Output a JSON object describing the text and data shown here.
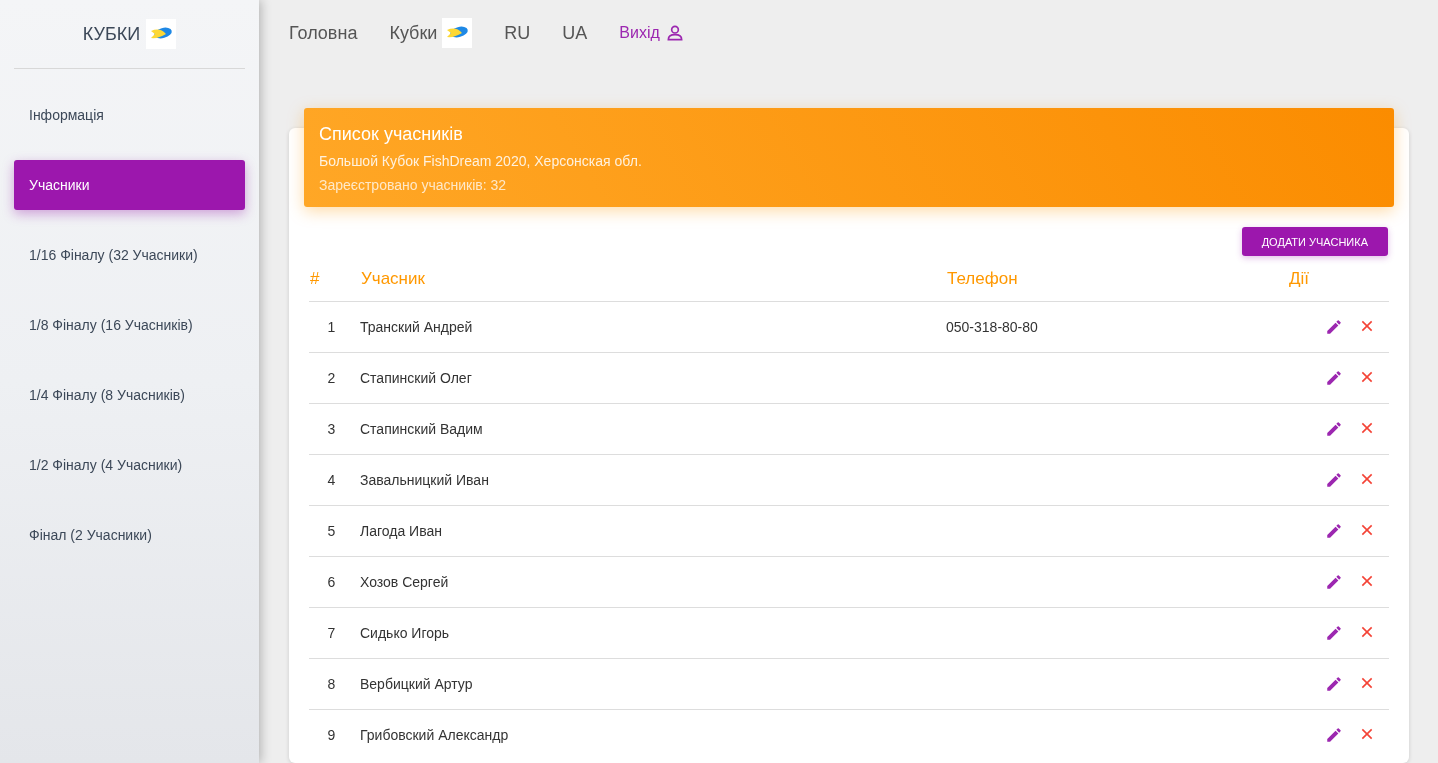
{
  "sidebar": {
    "brand": "КУБКИ",
    "items": [
      {
        "label": "Інформація",
        "selected": false
      },
      {
        "label": "Учасники",
        "selected": true
      },
      {
        "label": "1/16 Фіналу (32 Учасники)",
        "selected": false
      },
      {
        "label": "1/8 Фіналу (16 Учасників)",
        "selected": false
      },
      {
        "label": "1/4 Фіналу (8 Учасників)",
        "selected": false
      },
      {
        "label": "1/2 Фіналу (4 Учасники)",
        "selected": false
      },
      {
        "label": "Фінал (2 Учасники)",
        "selected": false
      }
    ]
  },
  "nav": [
    {
      "label": "Головна",
      "kind": "link"
    },
    {
      "label": "Кубки",
      "kind": "logo"
    },
    {
      "label": "RU",
      "kind": "link"
    },
    {
      "label": "UA",
      "kind": "link"
    },
    {
      "label": "Вихід",
      "kind": "logout"
    }
  ],
  "card": {
    "title": "Список учасників",
    "subtitle": "Большой Кубок FishDream 2020, Херсонская обл.",
    "count": "Зареєстровано учасників: 32",
    "add_button": "ДОДАТИ УЧАСНИКА"
  },
  "table": {
    "columns": [
      "#",
      "Учасник",
      "Телефон",
      "Дії"
    ],
    "rows": [
      {
        "index": "1",
        "name": "Транский Андрей",
        "phone": "050-318-80-80"
      },
      {
        "index": "2",
        "name": "Стапинский Олег"
      },
      {
        "index": "3",
        "name": "Стапинский Вадим"
      },
      {
        "index": "4",
        "name": "Завальницкий Иван"
      },
      {
        "index": "5",
        "name": "Лагода Иван"
      },
      {
        "index": "6",
        "name": "Хозов Сергей"
      },
      {
        "index": "7",
        "name": "Сидько Игорь"
      },
      {
        "index": "8",
        "name": "Вербицкий Артур"
      },
      {
        "index": "9",
        "name": "Грибовский Александр"
      }
    ]
  }
}
